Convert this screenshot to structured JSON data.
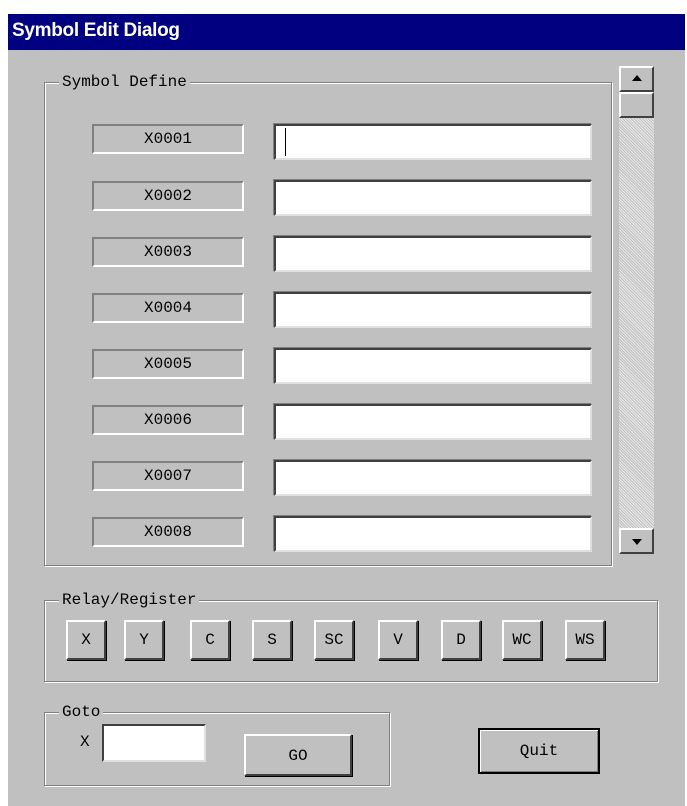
{
  "window": {
    "title": "Symbol Edit Dialog"
  },
  "symbol_define": {
    "legend": "Symbol Define",
    "rows": [
      {
        "label": "X0001",
        "value": ""
      },
      {
        "label": "X0002",
        "value": ""
      },
      {
        "label": "X0003",
        "value": ""
      },
      {
        "label": "X0004",
        "value": ""
      },
      {
        "label": "X0005",
        "value": ""
      },
      {
        "label": "X0006",
        "value": ""
      },
      {
        "label": "X0007",
        "value": ""
      },
      {
        "label": "X0008",
        "value": ""
      }
    ]
  },
  "relay_register": {
    "legend": "Relay/Register",
    "buttons": [
      "X",
      "Y",
      "C",
      "S",
      "SC",
      "V",
      "D",
      "WC",
      "WS"
    ]
  },
  "goto": {
    "legend": "Goto",
    "prefix": "X",
    "value": "",
    "go_label": "GO"
  },
  "quit_label": "Quit"
}
